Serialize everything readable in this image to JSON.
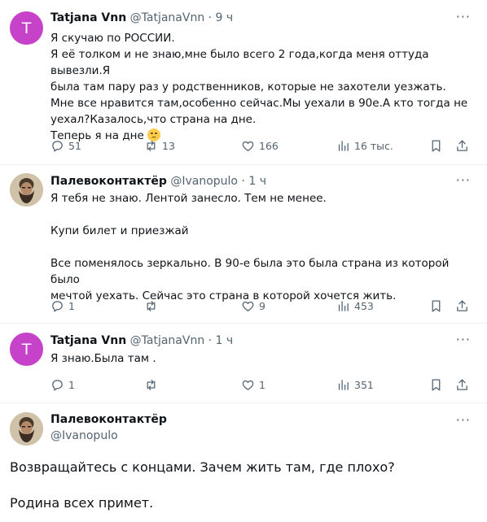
{
  "tweets": [
    {
      "avatar_letter": "T",
      "avatar_color": "#c643c9",
      "name": "Tatjana Vnn",
      "handle": "@TatjanaVnn",
      "time": "9 ч",
      "lines": [
        "Я скучаю по РОССИИ.",
        "Я её  толком и не знаю,мне было всего 2 года,когда меня оттуда вывезли.Я",
        "была там пару раз у родственников, которые не захотели уезжать.",
        "Мне все нравится там,особенно сейчас.Мы уехали в 90е.А кто тогда не",
        "уехал?Казалось,что страна на дне.",
        "Теперь я на дне"
      ],
      "emoji": "disappointed-face",
      "replies": "51",
      "reposts": "13",
      "likes": "166",
      "views": "16 тыс."
    },
    {
      "name": "Палевоконтактёр",
      "handle": "@Ivanopulo",
      "time": "1 ч",
      "lines": [
        "Я тебя не знаю. Лентой занесло. Тем не менее.",
        "",
        "Купи билет и приезжай",
        "",
        "Все поменялось зеркально. В 90-е была это была страна из которой было",
        "мечтой уехать. Сейчас это страна в которой хочется жить."
      ],
      "replies": "1",
      "reposts": "",
      "likes": "9",
      "views": "453"
    },
    {
      "avatar_letter": "T",
      "avatar_color": "#c643c9",
      "name": "Tatjana Vnn",
      "handle": "@TatjanaVnn",
      "time": "1 ч",
      "lines": [
        "Я знаю.Была там ."
      ],
      "replies": "1",
      "reposts": "",
      "likes": "1",
      "views": "351"
    }
  ],
  "main_tweet": {
    "name": "Палевоконтактёр",
    "handle": "@Ivanopulo",
    "lines": [
      "Возвращайтесь с концами. Зачем жить там, где плохо?",
      "",
      "Родина всех примет."
    ]
  },
  "ui": {
    "separator": "·",
    "more": "···"
  },
  "colors": {
    "text": "#0f1419",
    "secondary": "#536471",
    "divider": "#eff3f4"
  }
}
